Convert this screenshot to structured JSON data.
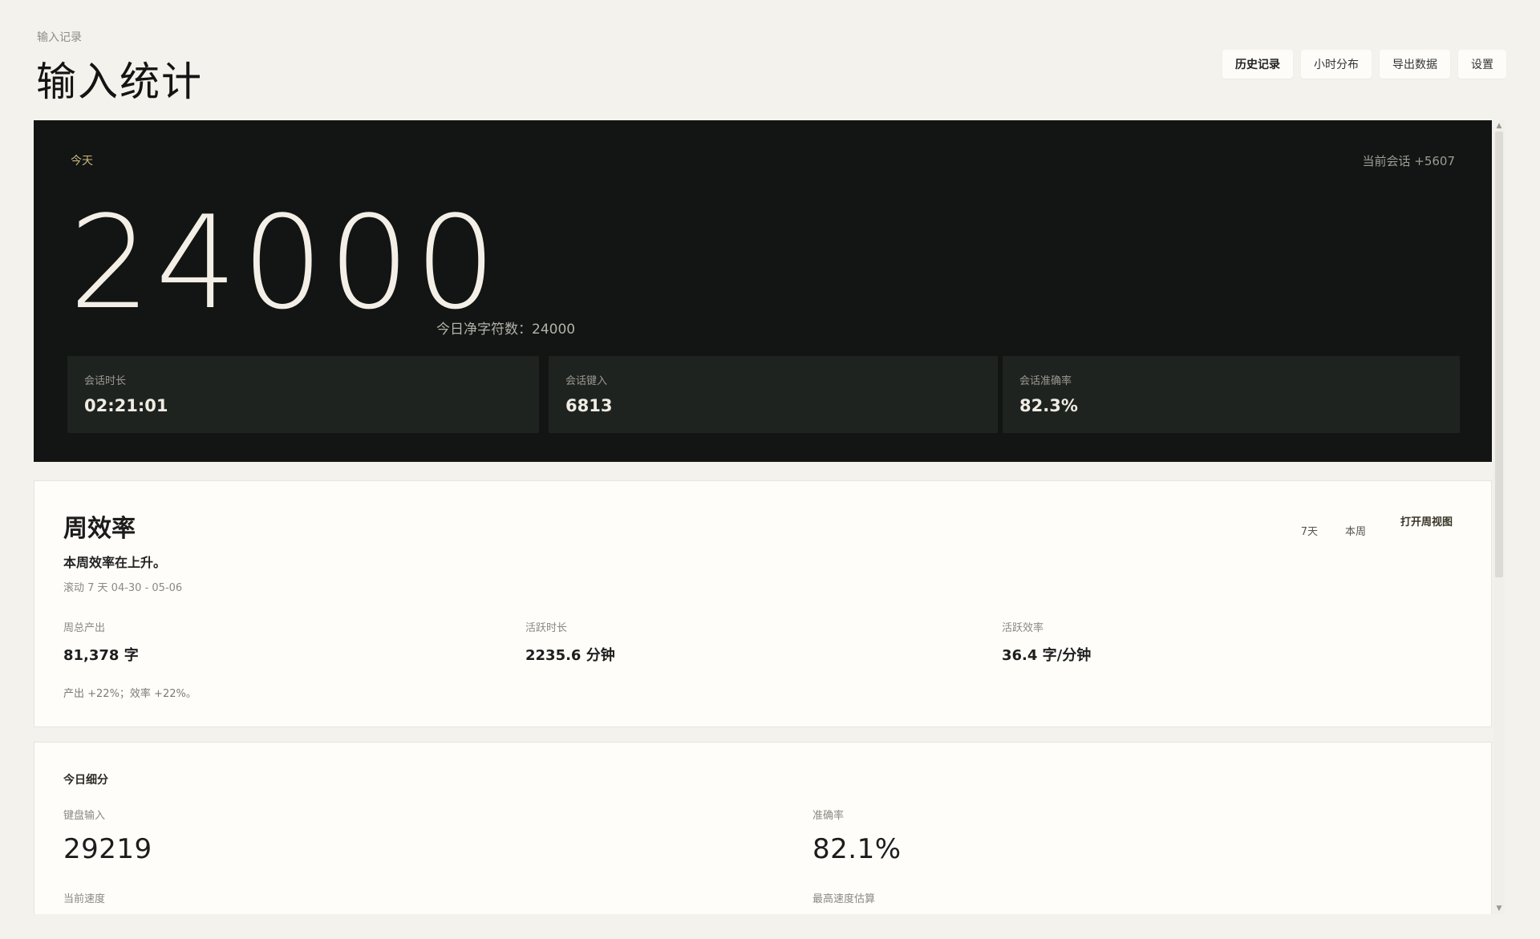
{
  "header": {
    "breadcrumb": "输入记录",
    "title": "输入统计",
    "buttons": [
      {
        "label": "历史记录",
        "active": true
      },
      {
        "label": "小时分布",
        "active": false
      },
      {
        "label": "导出数据",
        "active": false
      },
      {
        "label": "设置",
        "active": false
      }
    ]
  },
  "today": {
    "label": "今天",
    "session_gain": "当前会话 +5607",
    "big_number": "24000",
    "net_chars": "今日净字符数：24000",
    "stats": [
      {
        "label": "会话时长",
        "value": "02:21:01"
      },
      {
        "label": "会话键入",
        "value": "6813"
      },
      {
        "label": "会话准确率",
        "value": "82.3%"
      }
    ]
  },
  "week": {
    "title": "周效率",
    "trend": "本周效率在上升。",
    "range": "滚动 7 天  04-30 - 05-06",
    "range_buttons": [
      "7天",
      "本周"
    ],
    "open_view": "打开周视图",
    "metrics": [
      {
        "label": "周总产出",
        "value": "81,378 字"
      },
      {
        "label": "活跃时长",
        "value": "2235.6 分钟"
      },
      {
        "label": "活跃效率",
        "value": "36.4 字/分钟"
      }
    ],
    "change": "产出 +22%；效率 +22%。"
  },
  "detail": {
    "title": "今日细分",
    "items": [
      {
        "label": "键盘输入",
        "value": "29219"
      },
      {
        "label": "准确率",
        "value": "82.1%"
      },
      {
        "label": "当前速度",
        "value": ""
      },
      {
        "label": "最高速度估算",
        "value": ""
      }
    ]
  },
  "scrollbar": {
    "up_icon": "triangle-up",
    "down_icon": "triangle-down"
  }
}
